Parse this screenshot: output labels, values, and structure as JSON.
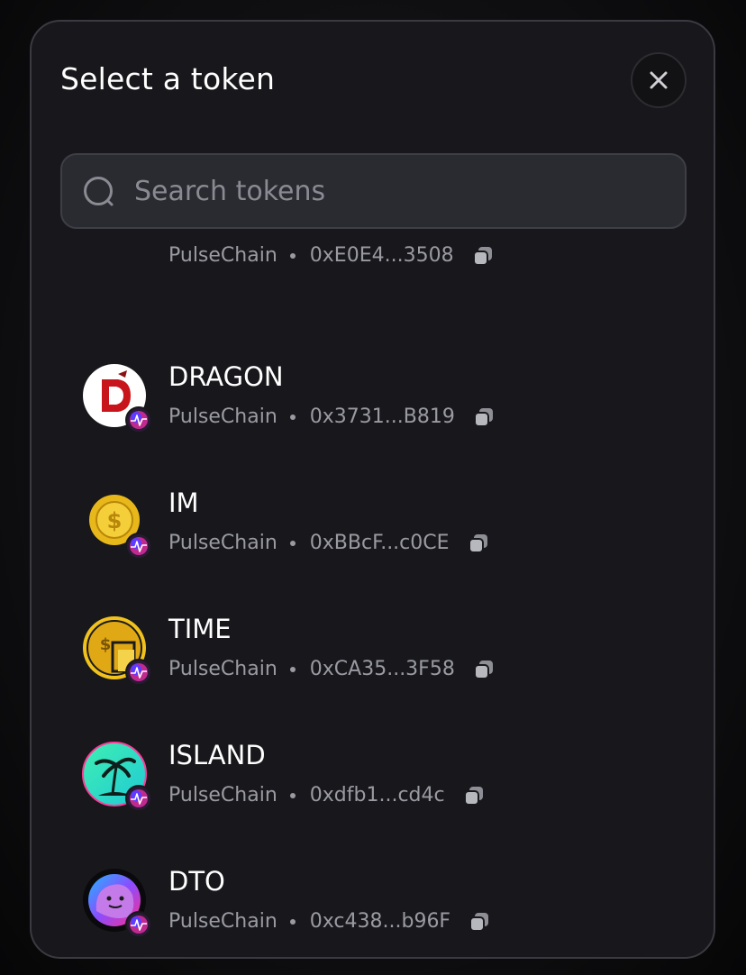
{
  "modal": {
    "title": "Select a token"
  },
  "search": {
    "placeholder": "Search tokens"
  },
  "tokens": [
    {
      "symbol": "",
      "chain": "PulseChain",
      "address": "0xE0E4...3508"
    },
    {
      "symbol": "DRAGON",
      "chain": "PulseChain",
      "address": "0x3731...B819"
    },
    {
      "symbol": "IM",
      "chain": "PulseChain",
      "address": "0xBBcF...c0CE"
    },
    {
      "symbol": "TIME",
      "chain": "PulseChain",
      "address": "0xCA35...3F58"
    },
    {
      "symbol": "ISLAND",
      "chain": "PulseChain",
      "address": "0xdfb1...cd4c"
    },
    {
      "symbol": "DTO",
      "chain": "PulseChain",
      "address": "0xc438...b96F"
    }
  ],
  "colors": {
    "modal_bg": "#18181c",
    "search_bg": "#2a2a31",
    "text_primary": "#ffffff",
    "text_secondary": "#9a9aa2"
  },
  "icons": {
    "close": "close-icon",
    "search": "search-icon",
    "copy": "copy-icon",
    "chain": "pulsechain-badge-icon"
  }
}
